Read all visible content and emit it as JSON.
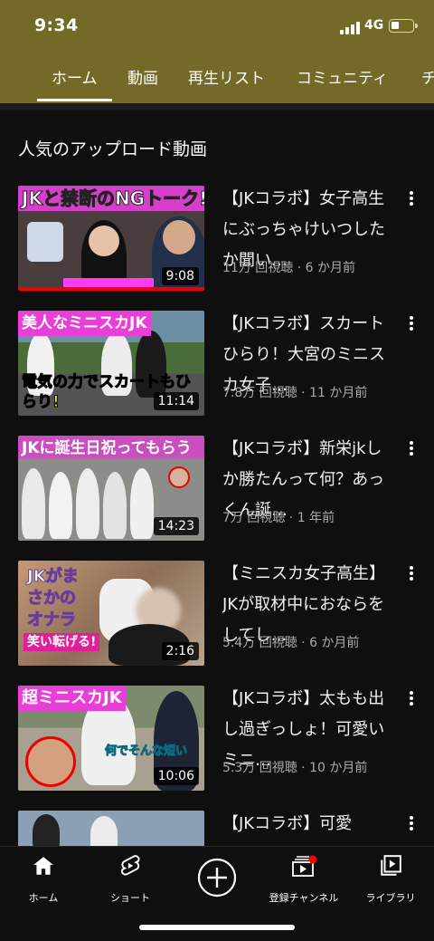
{
  "status_bar": {
    "time": "9:34",
    "network": "4G"
  },
  "tabs": [
    {
      "label": "ホーム",
      "active": true
    },
    {
      "label": "動画",
      "active": false
    },
    {
      "label": "再生リスト",
      "active": false
    },
    {
      "label": "コミュニティ",
      "active": false
    },
    {
      "label": "チ",
      "active": false
    }
  ],
  "section": {
    "title": "人気のアップロード動画"
  },
  "videos": [
    {
      "title": "【JKコラボ】女子高生にぶっちゃけいつしたか聞い…",
      "meta": "11万 回視聴 · 6 か月前",
      "duration": "9:08",
      "thumb_text": "JKと禁断のNGトーク!"
    },
    {
      "title": "【JKコラボ】スカートひらり！大宮のミニスカ女子…",
      "meta": "7.8万 回視聴 · 11 か月前",
      "duration": "11:14",
      "thumb_text": "美人なミニスカJK",
      "thumb_text2": "電気の力でスカートもひらり!"
    },
    {
      "title": "【JKコラボ】新栄jkしか勝たんって何？あっくん誕…",
      "meta": "7万 回視聴 · 1 年前",
      "duration": "14:23",
      "thumb_text": "JKに誕生日祝ってもらう"
    },
    {
      "title": "【ミニスカ女子高生】JKが取材中におならをしてし…",
      "meta": "5.4万 回視聴 · 6 か月前",
      "duration": "2:16",
      "thumb_text": "JKがまさかのオナラ",
      "thumb_text2": "笑い転げる!"
    },
    {
      "title": "【JKコラボ】太もも出し過ぎっしょ！可愛いミニ…",
      "meta": "5.3万 回視聴 · 10 か月前",
      "duration": "10:06",
      "thumb_text": "超ミニスカJK",
      "thumb_text2": "何でそんな短い"
    },
    {
      "title": "【JKコラボ】可愛",
      "meta": "",
      "duration": "",
      "thumb_text": ""
    }
  ],
  "bottom_nav": [
    {
      "label": "ホーム",
      "icon": "home-icon"
    },
    {
      "label": "ショート",
      "icon": "shorts-icon"
    },
    {
      "label": "",
      "icon": "create-icon"
    },
    {
      "label": "登録チャンネル",
      "icon": "subscriptions-icon"
    },
    {
      "label": "ライブラリ",
      "icon": "library-icon"
    }
  ],
  "colors": {
    "header": "#736a28",
    "background": "#0f0f0f",
    "accent_red": "#ff0000"
  }
}
